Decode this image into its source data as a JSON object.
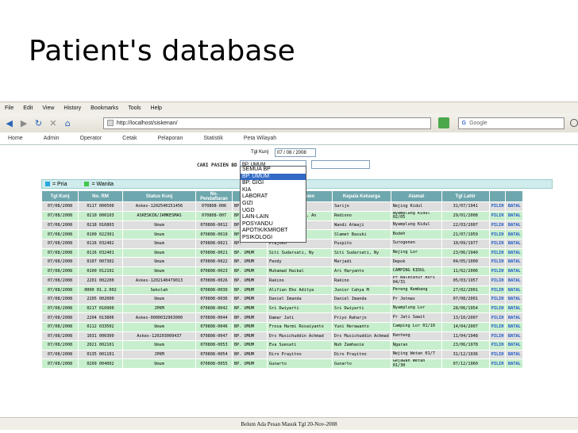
{
  "slide": {
    "title": "Patient's database"
  },
  "browser": {
    "menu": [
      "File",
      "Edit",
      "View",
      "History",
      "Bookmarks",
      "Tools",
      "Help"
    ],
    "url": "http://localhost/siskenan/",
    "search_engine": "Google",
    "search_placeholder": "Google"
  },
  "app": {
    "nav": [
      "Home",
      "Admin",
      "Operator",
      "Cetak",
      "Pelaporan",
      "Statistik",
      "Peta Wilayah"
    ]
  },
  "filter": {
    "tgl_label": "Tgl Kunj",
    "tgl_value": "07 / 08 / 2008",
    "cari_label": "CARI PASIEN BD",
    "bp_value": "BP. UMUM",
    "options": [
      "SEMUA BP",
      "BP. UMUM",
      "BP. GIGI",
      "KIA",
      "LABORAT",
      "GIZI",
      "UGD",
      "LAIN-LAIN",
      "POSYANDU",
      "APOTIK/KMROBT",
      "PSIKOLOGI"
    ],
    "selected_index": 1
  },
  "legend": {
    "pria": "= Pria",
    "wanita": "= Wanita",
    "pria_color": "#2aa6e0",
    "wanita_color": "#3ec84a"
  },
  "table": {
    "headers": [
      "Tgl Kunj",
      "No. RM",
      "Status Kunj",
      "No. Pendaftaran",
      "BP",
      "Nama Pasien",
      "Kepala Keluarga",
      "Alamat",
      "Tgl Lahir",
      "",
      ""
    ],
    "rows": [
      [
        "07/08/2008",
        "0117 000500",
        "Askes-1202540151456",
        "070808-006",
        "BP.",
        "",
        "Sarijo",
        "Nejing Kidul",
        "31/07/1941",
        "PILIH",
        "BATAL"
      ],
      [
        "07/08/2008",
        "0210 000103",
        "ASKESKIN/JAMKESMAS",
        "070808-007",
        "BP.",
        "Buddin Atballah, An",
        "Rediono",
        "Nyamplung Kidul 02/05",
        "29/01/2008",
        "PILIH",
        "BATAL"
      ],
      [
        "07/08/2008",
        "0218 016803",
        "Umum",
        "070808-0012",
        "BP.",
        "fka Satrio",
        "Wandi Atmaji",
        "Nyamplung Kidul",
        "22/03/2007",
        "PILIH",
        "BATAL"
      ],
      [
        "07/08/2008",
        "0100 022301",
        "Umum",
        "070808-0019",
        "BP.",
        ", Ny",
        "Slamet Basuki",
        "Bodeh",
        "21/07/1959",
        "PILIH",
        "BATAL"
      ],
      [
        "07/08/2008",
        "0116 032402",
        "Umum",
        "070808-0021",
        "BP.",
        "Prajoko",
        "Puspito",
        "Surogenen",
        "10/09/1977",
        "PILIH",
        "BATAL"
      ],
      [
        "07/08/2008",
        "0116 032401",
        "Umum",
        "070808-0021",
        "BP. UMUM",
        "Siti Sudarsati, Ny",
        "Siti Sudarsati, Ny",
        "Nejing Lor",
        "23/06/1940",
        "PILIH",
        "BATAL"
      ],
      [
        "07/08/2008",
        "0107 007302",
        "Umum",
        "070808-0022",
        "BP. UMUM",
        "Fendy",
        "Marjadi",
        "Depok",
        "04/05/1000",
        "PILIH",
        "BATAL"
      ],
      [
        "07/08/2008",
        "0100 012102",
        "Umum",
        "070808-0023",
        "BP. UMUM",
        "Muhamad Haikal",
        "Ari Haryanto",
        "CAMPING KIDUL",
        "11/02/2006",
        "PILIH",
        "BATAL"
      ],
      [
        "07/08/2008",
        "2201 002200",
        "Askes-1202140479013",
        "070808-0026",
        "BP. UMUM",
        "Rakino",
        "Rakino",
        "Pr Balecatur Asri 04/31",
        "05/03/1957",
        "PILIH",
        "BATAL"
      ],
      [
        "07/08/2008",
        "0000 01.2.002",
        "Sekolah",
        "070808-0030",
        "BP. UMUM",
        "Alifian Eko Aditya",
        "Junior Cahya M",
        "Pereng Kembang",
        "27/02/2001",
        "PILIH",
        "BATAL"
      ],
      [
        "07/08/2008",
        "2205 002000",
        "Umum",
        "070808-0036",
        "BP. UMUM",
        "Daniel Imanda",
        "Daniel Imanda",
        "Pr Jetmas",
        "07/08/2001",
        "PILIH",
        "BATAL"
      ],
      [
        "07/08/2008",
        "0217 010900",
        "JPKM",
        "070808-0042",
        "BP. UMUM",
        "Sri Dwiyarti",
        "Sri Dwiyarti",
        "Nyamplung Lor",
        "28/06/1954",
        "PILIH",
        "BATAL"
      ],
      [
        "07/08/2008",
        "2204 013806",
        "Askes-0000032963000",
        "070808-0044",
        "BP. UMUM",
        "Damar Jati",
        "Priyo Raharjo",
        "Pr Jati Sawit",
        "13/10/2007",
        "PILIH",
        "BATAL"
      ],
      [
        "07/08/2008",
        "0112 033502",
        "Umum",
        "070808-0046",
        "BP. UMUM",
        "Frosa Harmi Rosaiyanto",
        "Yuni Herawanto",
        "Camping Lor 01/10",
        "14/04/2007",
        "PILIH",
        "BATAL"
      ],
      [
        "07/08/2008",
        "1031 000300",
        "Askes-120203009437",
        "070808-0047",
        "BP. UMUM",
        "Drs Musichuddin Achmad",
        "Drs Musichuddin Achmad",
        "Kenteng",
        "11/04/1948",
        "PILIH",
        "BATAL"
      ],
      [
        "07/08/2008",
        "2021 002101",
        "Umum",
        "070808-0053",
        "BP. UMUM",
        "Eva Suesati",
        "Nuh Zamhasie",
        "Ngaran",
        "23/06/1978",
        "PILIH",
        "BATAL"
      ],
      [
        "07/08/2008",
        "0135 001101",
        "JPKM",
        "070808-0054",
        "BP. UMUM",
        "Diro Prayitno",
        "Diro Prayitno",
        "Nejing Wetan 01/7",
        "31/12/1936",
        "PILIH",
        "BATAL"
      ],
      [
        "07/08/2008",
        "0209 004002",
        "Umum",
        "070808-0055",
        "BP. UMUM",
        "Gunarto",
        "Gunarto",
        "Gejawan Wetan 01/30",
        "07/12/1960",
        "PILIH",
        "BATAL"
      ]
    ],
    "row_colors": [
      "grey",
      "green",
      "grey",
      "green",
      "grey",
      "green",
      "grey",
      "green",
      "grey",
      "green",
      "grey",
      "green",
      "grey",
      "green",
      "grey",
      "green",
      "grey",
      "green"
    ]
  },
  "status": {
    "message": "Belum Ada Pesan Masuk Tgl 20-Nov-2008"
  }
}
